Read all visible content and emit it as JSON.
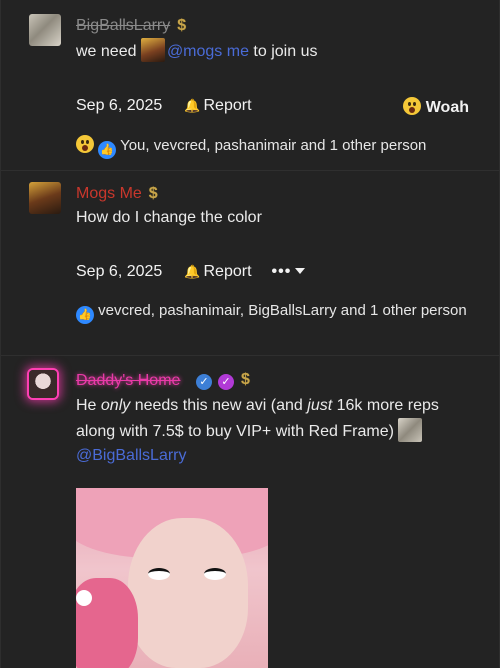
{
  "posts": [
    {
      "username": "BigBallsLarry",
      "badge_symbol": "$",
      "message": {
        "prefix": "we need ",
        "mention": "@mogs me",
        "suffix": " to join us"
      },
      "date": "Sep 6, 2025",
      "report_label": "Report",
      "reaction_button": "Woah",
      "reactions_text": "You, vevcred, pashanimair and 1 other person"
    },
    {
      "username": "Mogs Me",
      "badge_symbol": "$",
      "message": "How do I change the color",
      "date": "Sep 6, 2025",
      "report_label": "Report",
      "more_label": "•••",
      "reactions_text": "vevcred, pashanimair, BigBallsLarry and 1 other person"
    },
    {
      "username": "Daddy's Home",
      "badge_symbol": "$",
      "message": {
        "p1": "He ",
        "em1": "only",
        "p2": " needs this new avi (and ",
        "em2": "just",
        "p3": " 16k more reps along with 7.5$ to buy VIP+ with Red Frame) ",
        "mention": "@BigBallsLarry"
      }
    }
  ],
  "colors": {
    "mention": "#4a6bd6",
    "mogs_name": "#c9372c",
    "daddy_name": "#e83aa8",
    "background": "#232323"
  }
}
